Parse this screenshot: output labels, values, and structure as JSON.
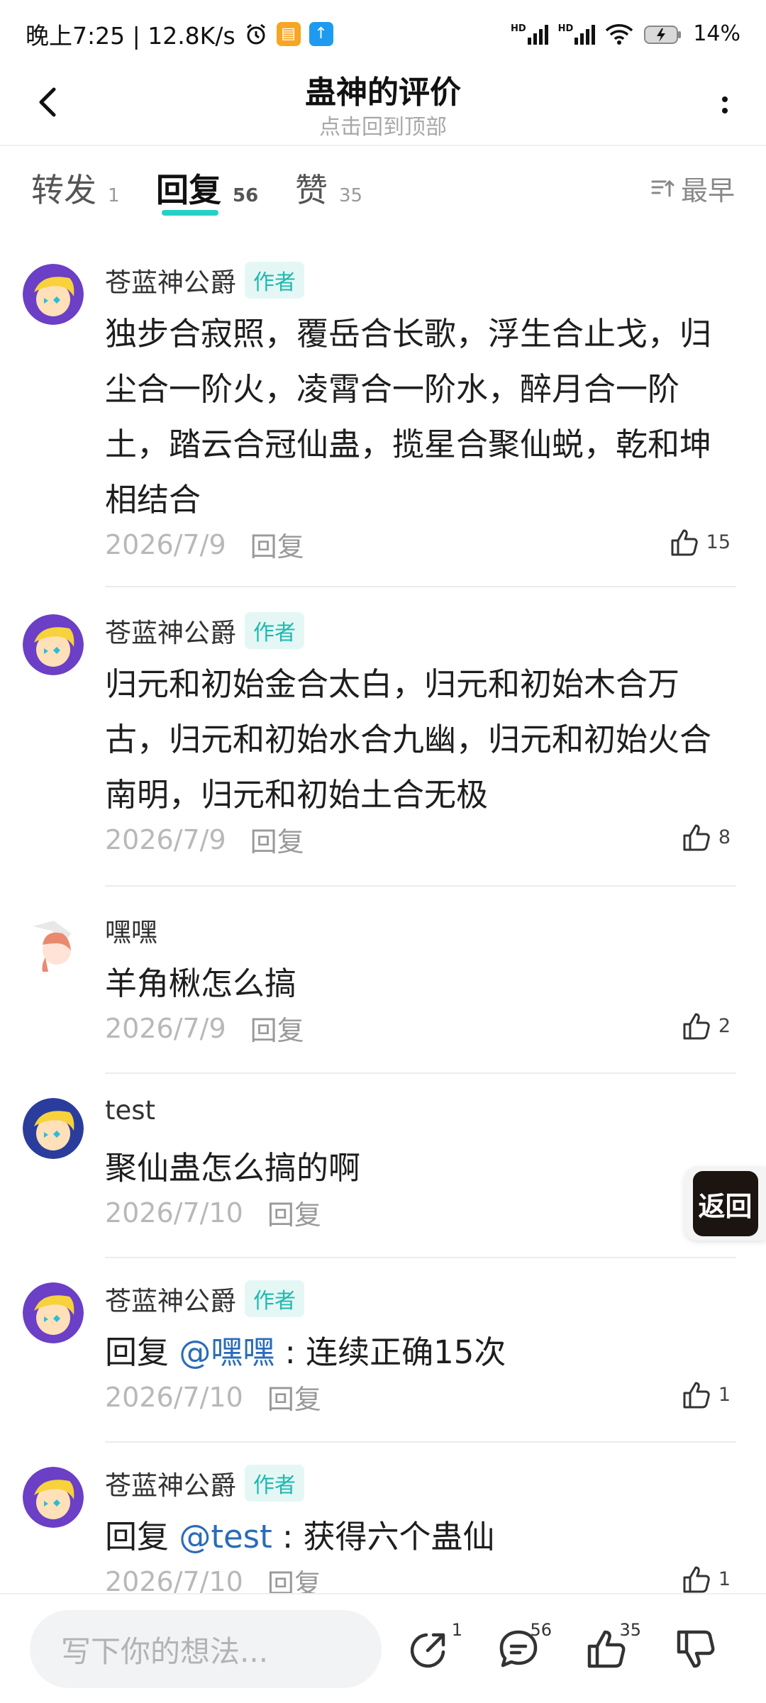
{
  "status_bar": {
    "time_speed": "晚上7:25 | 12.8K/s",
    "hd1": "HD",
    "hd2": "HD",
    "battery": "14%"
  },
  "header": {
    "title": "蛊神的评价",
    "subtitle": "点击回到顶部"
  },
  "tabs": [
    {
      "label": "转发",
      "count": "1"
    },
    {
      "label": "回复",
      "count": "56"
    },
    {
      "label": "赞",
      "count": "35"
    }
  ],
  "sort": {
    "label": "最早"
  },
  "comments": [
    {
      "user": "苍蓝神公爵",
      "badge": "作者",
      "text": "独步合寂照，覆岳合长歌，浮生合止戈，归尘合一阶火，凌霄合一阶水，醉月合一阶土，踏云合冠仙蛊，揽星合聚仙蜕，乾和坤相结合",
      "date": "2026/7/9",
      "reply": "回复",
      "likes": "15"
    },
    {
      "user": "苍蓝神公爵",
      "badge": "作者",
      "text": "归元和初始金合太白，归元和初始木合万古，归元和初始水合九幽，归元和初始火合南明，归元和初始土合无极",
      "date": "2026/7/9",
      "reply": "回复",
      "likes": "8"
    },
    {
      "user": "嘿嘿",
      "text": "羊角楸怎么搞",
      "date": "2026/7/9",
      "reply": "回复",
      "likes": "2"
    },
    {
      "user": "test",
      "text": "聚仙蛊怎么搞的啊",
      "date": "2026/7/10",
      "reply": "回复"
    },
    {
      "user": "苍蓝神公爵",
      "badge": "作者",
      "prefix": "回复 ",
      "mention": "@嘿嘿",
      "suffix": " : 连续正确15次",
      "date": "2026/7/10",
      "reply": "回复",
      "likes": "1"
    },
    {
      "user": "苍蓝神公爵",
      "badge": "作者",
      "prefix": "回复 ",
      "mention": "@test",
      "suffix": " : 获得六个蛊仙",
      "date": "2026/7/10",
      "reply": "回复",
      "likes": "1"
    }
  ],
  "float_button": {
    "label": "返回"
  },
  "bottom_bar": {
    "placeholder": "写下你的想法...",
    "share_count": "1",
    "comment_count": "56",
    "like_count": "35"
  },
  "colors": {
    "accent": "#26d0c6",
    "badge_text": "#1fb9b0",
    "mention": "#2a6cb8"
  }
}
